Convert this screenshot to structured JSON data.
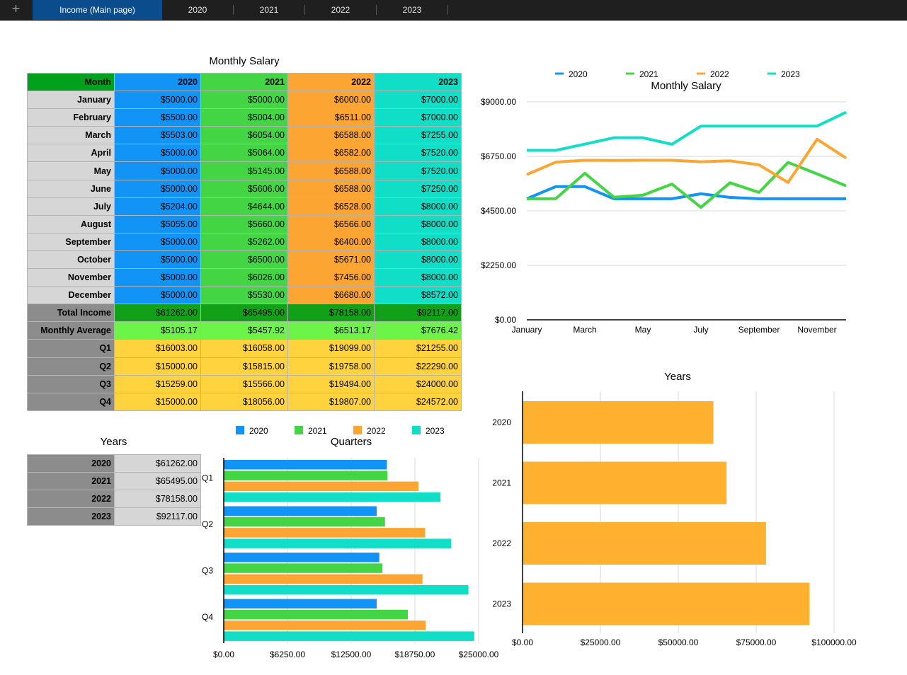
{
  "tabs": [
    {
      "label": "Income (Main page)",
      "active": true
    },
    {
      "label": "2020",
      "active": false
    },
    {
      "label": "2021",
      "active": false
    },
    {
      "label": "2022",
      "active": false
    },
    {
      "label": "2023",
      "active": false
    }
  ],
  "add_tab_icon": "plus-icon",
  "colors": {
    "2020": "#1194f5",
    "2021": "#43d544",
    "2022": "#fca532",
    "2023": "#10dec6",
    "years_bar": "#fdb12e"
  },
  "salary_table": {
    "title": "Monthly Salary",
    "headers": [
      "Month",
      "2020",
      "2021",
      "2022",
      "2023"
    ],
    "rows": [
      [
        "January",
        "$5000.00",
        "$5000.00",
        "$6000.00",
        "$7000.00"
      ],
      [
        "February",
        "$5500.00",
        "$5004.00",
        "$6511.00",
        "$7000.00"
      ],
      [
        "March",
        "$5503.00",
        "$6054.00",
        "$6588.00",
        "$7255.00"
      ],
      [
        "April",
        "$5000.00",
        "$5064.00",
        "$6582.00",
        "$7520.00"
      ],
      [
        "May",
        "$5000.00",
        "$5145.00",
        "$6588.00",
        "$7520.00"
      ],
      [
        "June",
        "$5000.00",
        "$5606.00",
        "$6588.00",
        "$7250.00"
      ],
      [
        "July",
        "$5204.00",
        "$4644.00",
        "$6528.00",
        "$8000.00"
      ],
      [
        "August",
        "$5055.00",
        "$5660.00",
        "$6566.00",
        "$8000.00"
      ],
      [
        "September",
        "$5000.00",
        "$5262.00",
        "$6400.00",
        "$8000.00"
      ],
      [
        "October",
        "$5000.00",
        "$6500.00",
        "$5671.00",
        "$8000.00"
      ],
      [
        "November",
        "$5000.00",
        "$6026.00",
        "$7456.00",
        "$8000.00"
      ],
      [
        "December",
        "$5000.00",
        "$5530.00",
        "$6680.00",
        "$8572.00"
      ]
    ],
    "total": [
      "Total Income",
      "$61262.00",
      "$65495.00",
      "$78158.00",
      "$92117.00"
    ],
    "average": [
      "Monthly Average",
      "$5105.17",
      "$5457.92",
      "$6513.17",
      "$7676.42"
    ],
    "quarters": [
      [
        "Q1",
        "$16003.00",
        "$16058.00",
        "$19099.00",
        "$21255.00"
      ],
      [
        "Q2",
        "$15000.00",
        "$15815.00",
        "$19758.00",
        "$22290.00"
      ],
      [
        "Q3",
        "$15259.00",
        "$15566.00",
        "$19494.00",
        "$24000.00"
      ],
      [
        "Q4",
        "$15000.00",
        "$18056.00",
        "$19807.00",
        "$24572.00"
      ]
    ]
  },
  "years_table": {
    "title": "Years",
    "rows": [
      [
        "2020",
        "$61262.00"
      ],
      [
        "2021",
        "$65495.00"
      ],
      [
        "2022",
        "$78158.00"
      ],
      [
        "2023",
        "$92117.00"
      ]
    ]
  },
  "chart_data": [
    {
      "type": "line",
      "title": "Monthly Salary",
      "legend_position": "top",
      "x": [
        "January",
        "February",
        "March",
        "April",
        "May",
        "June",
        "July",
        "August",
        "September",
        "October",
        "November",
        "December"
      ],
      "x_tick_labels": [
        "January",
        "March",
        "May",
        "July",
        "September",
        "November"
      ],
      "y_tick_labels": [
        "$0.00",
        "$2250.00",
        "$4500.00",
        "$6750.00",
        "$9000.00"
      ],
      "ylim": [
        0,
        9000
      ],
      "grid": true,
      "series": [
        {
          "name": "2020",
          "values": [
            5000,
            5500,
            5503,
            5000,
            5000,
            5000,
            5204,
            5055,
            5000,
            5000,
            5000,
            5000
          ]
        },
        {
          "name": "2021",
          "values": [
            5000,
            5004,
            6054,
            5064,
            5145,
            5606,
            4644,
            5660,
            5262,
            6500,
            6026,
            5530
          ]
        },
        {
          "name": "2022",
          "values": [
            6000,
            6511,
            6588,
            6582,
            6588,
            6588,
            6528,
            6566,
            6400,
            5671,
            7456,
            6680
          ]
        },
        {
          "name": "2023",
          "values": [
            7000,
            7000,
            7255,
            7520,
            7520,
            7250,
            8000,
            8000,
            8000,
            8000,
            8000,
            8572
          ]
        }
      ]
    },
    {
      "type": "bar",
      "orientation": "horizontal",
      "title": "Quarters",
      "legend_position": "top",
      "categories": [
        "Q1",
        "Q2",
        "Q3",
        "Q4"
      ],
      "x_tick_labels": [
        "$0.00",
        "$6250.00",
        "$12500.00",
        "$18750.00",
        "$25000.00"
      ],
      "xlim": [
        0,
        25000
      ],
      "grid": true,
      "series": [
        {
          "name": "2020",
          "values": [
            16003,
            15000,
            15259,
            15000
          ]
        },
        {
          "name": "2021",
          "values": [
            16058,
            15815,
            15566,
            18056
          ]
        },
        {
          "name": "2022",
          "values": [
            19099,
            19758,
            19494,
            19807
          ]
        },
        {
          "name": "2023",
          "values": [
            21255,
            22290,
            24000,
            24572
          ]
        }
      ]
    },
    {
      "type": "bar",
      "orientation": "horizontal",
      "title": "Years",
      "categories": [
        "2020",
        "2021",
        "2022",
        "2023"
      ],
      "values": [
        61262,
        65495,
        78158,
        92117
      ],
      "x_tick_labels": [
        "$0.00",
        "$25000.00",
        "$50000.00",
        "$75000.00",
        "$100000.00"
      ],
      "xlim": [
        0,
        100000
      ],
      "grid": true
    }
  ]
}
